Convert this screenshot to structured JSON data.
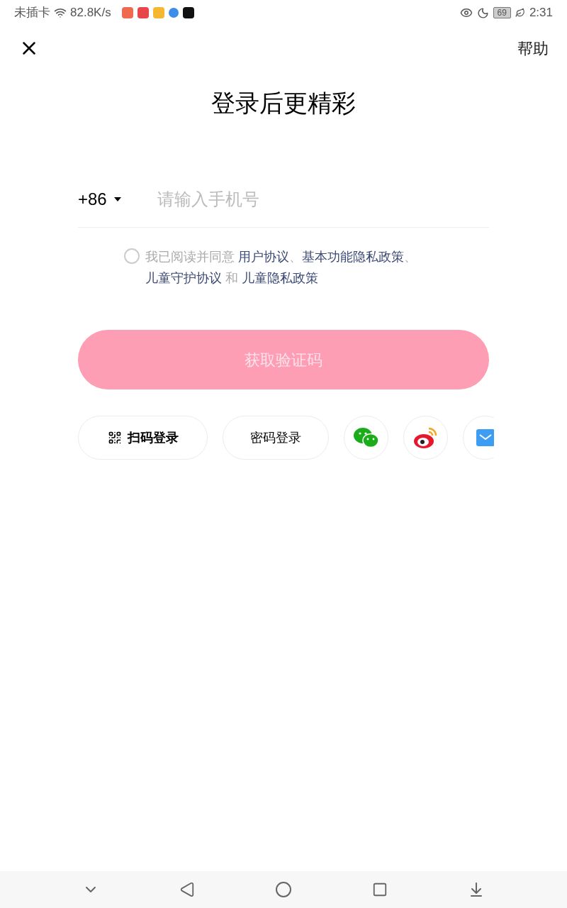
{
  "status_bar": {
    "carrier": "未插卡",
    "speed": "82.8K/s",
    "battery": "69",
    "time": "2:31"
  },
  "top_bar": {
    "help": "帮助"
  },
  "title": "登录后更精彩",
  "phone": {
    "country_code": "+86",
    "placeholder": "请输入手机号"
  },
  "agreement": {
    "checked": false,
    "parts": [
      {
        "kind": "plain",
        "text": "我已阅读并同意 "
      },
      {
        "kind": "link",
        "text": "用户协议"
      },
      {
        "kind": "plain",
        "text": "、"
      },
      {
        "kind": "link",
        "text": "基本功能隐私政策"
      },
      {
        "kind": "plain",
        "text": "、 "
      },
      {
        "kind": "link",
        "text": "儿童守护协议"
      },
      {
        "kind": "plain",
        "text": " 和 "
      },
      {
        "kind": "link",
        "text": "儿童隐私政策"
      }
    ]
  },
  "submit": {
    "label": "获取验证码",
    "disabled": true
  },
  "login_options": [
    {
      "kind": "qr",
      "label": "扫码登录"
    },
    {
      "kind": "password",
      "label": "密码登录"
    },
    {
      "kind": "wechat"
    },
    {
      "kind": "weibo"
    },
    {
      "kind": "mail"
    }
  ]
}
